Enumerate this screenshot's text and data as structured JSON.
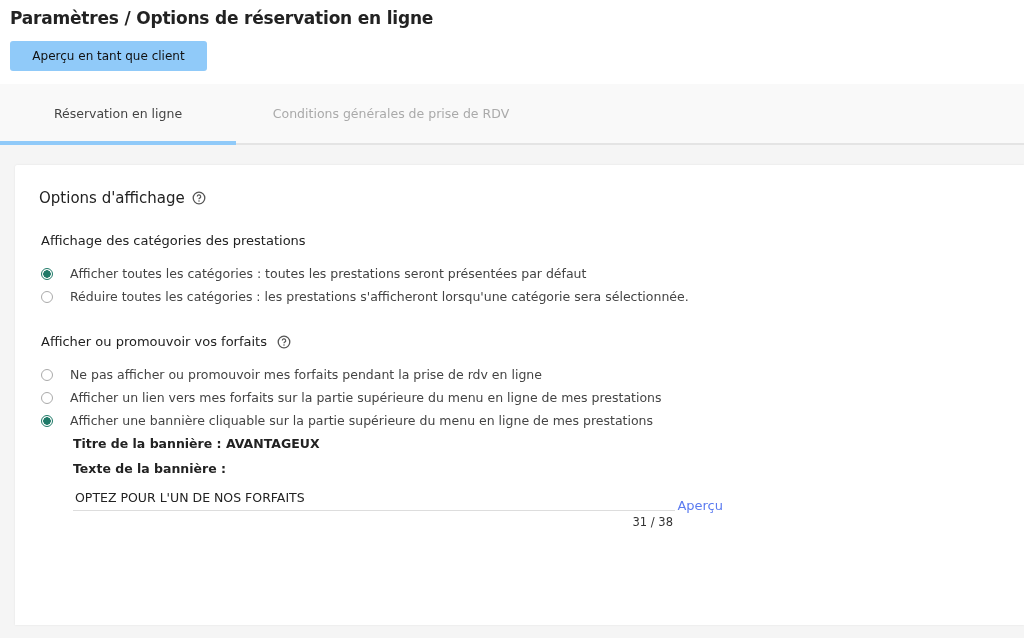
{
  "page_title": "Paramètres / Options de réservation en ligne",
  "preview_button": "Aperçu en tant que client",
  "tabs": [
    {
      "label": "Réservation en ligne",
      "selected": true
    },
    {
      "label": "Conditions générales de prise de RDV",
      "selected": false
    }
  ],
  "card": {
    "title": "Options d'affichage",
    "help": true,
    "groups": [
      {
        "title": "Affichage des catégories des prestations",
        "help": false,
        "options": [
          {
            "label": "Afficher toutes les catégories : toutes les prestations seront présentées par défaut",
            "selected": true
          },
          {
            "label": "Réduire toutes les catégories : les prestations s'afficheront lorsqu'une catégorie sera sélectionnée.",
            "selected": false
          }
        ]
      },
      {
        "title": "Afficher ou promouvoir vos forfaits",
        "help": true,
        "options": [
          {
            "label": "Ne pas afficher ou promouvoir mes forfaits pendant la prise de rdv en ligne",
            "selected": false
          },
          {
            "label": "Afficher un lien vers mes forfaits sur la partie supérieure du menu en ligne de mes prestations",
            "selected": false
          },
          {
            "label": "Afficher une bannière cliquable sur la partie supérieure du menu en ligne de mes prestations",
            "selected": true
          }
        ],
        "banner": {
          "title_line": "Titre de la bannière : AVANTAGEUX",
          "text_label": "Texte de la bannière :",
          "text_value": "OPTEZ POUR L'UN DE NOS FORFAITS",
          "counter": "31 / 38",
          "preview_link": "Aperçu"
        }
      }
    ]
  }
}
